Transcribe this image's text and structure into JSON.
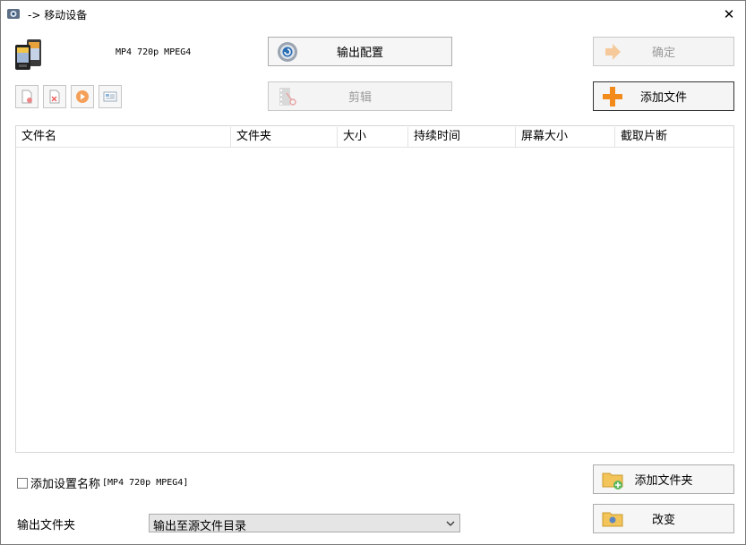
{
  "window": {
    "title": "-> 移动设备",
    "close_glyph": "✕"
  },
  "profile": {
    "label": "MP4 720p MPEG4"
  },
  "buttons": {
    "output_config": "输出配置",
    "edit": "剪辑",
    "ok": "确定",
    "add_file": "添加文件",
    "add_folder": "添加文件夹",
    "change": "改变"
  },
  "file_list": {
    "columns": [
      "文件名",
      "文件夹",
      "大小",
      "持续时间",
      "屏幕大小",
      "截取片断"
    ],
    "rows": []
  },
  "options": {
    "add_setting_name_label": "添加设置名称",
    "add_setting_name_checked": false,
    "add_setting_name_profile": "[MP4 720p MPEG4]"
  },
  "output": {
    "label": "输出文件夹",
    "selected": "输出至源文件目录"
  },
  "colors": {
    "accent_orange": "#f28a1c",
    "accent_blue": "#2b6db3"
  }
}
